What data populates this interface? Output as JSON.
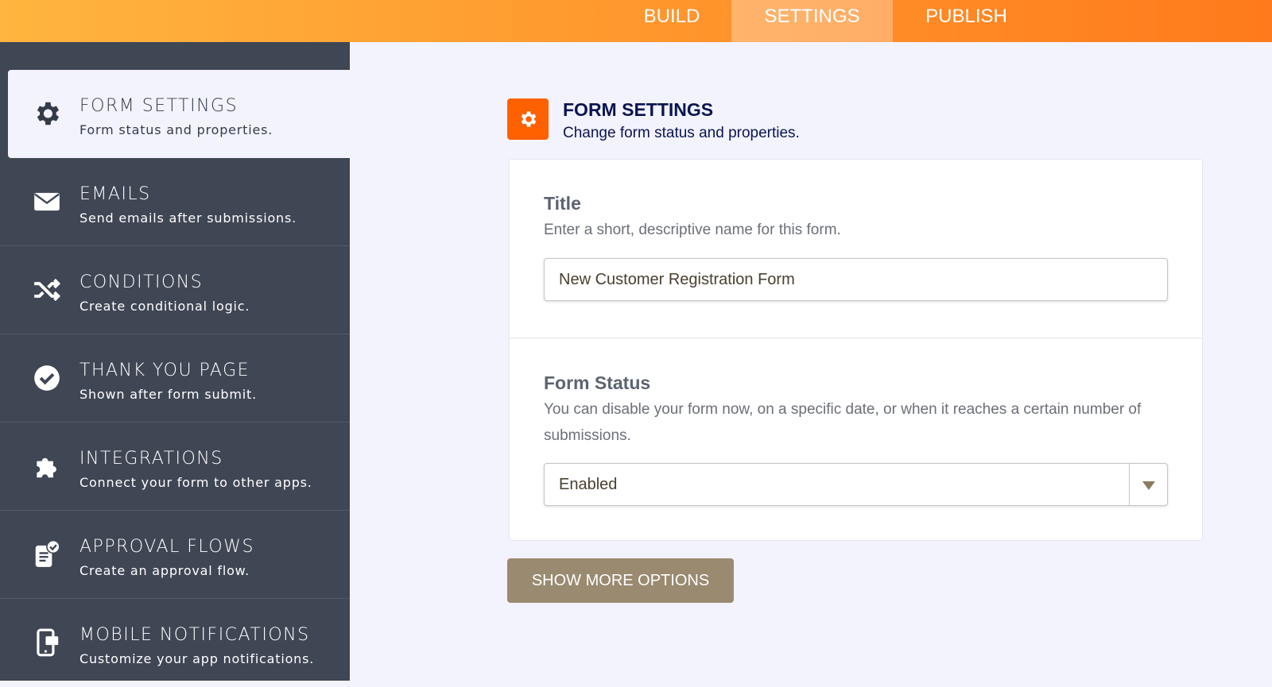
{
  "top_tabs": [
    {
      "label": "BUILD"
    },
    {
      "label": "SETTINGS",
      "active": true
    },
    {
      "label": "PUBLISH"
    }
  ],
  "sidebar": {
    "items": [
      {
        "title": "FORM SETTINGS",
        "subtitle": "Form status and properties.",
        "icon": "gear-icon",
        "active": true
      },
      {
        "title": "EMAILS",
        "subtitle": "Send emails after submissions.",
        "icon": "envelope-icon"
      },
      {
        "title": "CONDITIONS",
        "subtitle": "Create conditional logic.",
        "icon": "shuffle-icon"
      },
      {
        "title": "THANK YOU PAGE",
        "subtitle": "Shown after form submit.",
        "icon": "check-circle-icon"
      },
      {
        "title": "INTEGRATIONS",
        "subtitle": "Connect your form to other apps.",
        "icon": "puzzle-icon"
      },
      {
        "title": "APPROVAL FLOWS",
        "subtitle": "Create an approval flow.",
        "icon": "approval-icon"
      },
      {
        "title": "MOBILE NOTIFICATIONS",
        "subtitle": "Customize your app notifications.",
        "icon": "mobile-icon"
      }
    ]
  },
  "header": {
    "title": "FORM SETTINGS",
    "subtitle": "Change form status and properties.",
    "accent": "#ff6100"
  },
  "title_field": {
    "label": "Title",
    "description": "Enter a short, descriptive name for this form.",
    "value": "New Customer Registration Form"
  },
  "status_field": {
    "label": "Form Status",
    "description": "You can disable your form now, on a specific date, or when it reaches a certain number of submissions.",
    "value": "Enabled"
  },
  "show_more_label": "SHOW MORE OPTIONS"
}
